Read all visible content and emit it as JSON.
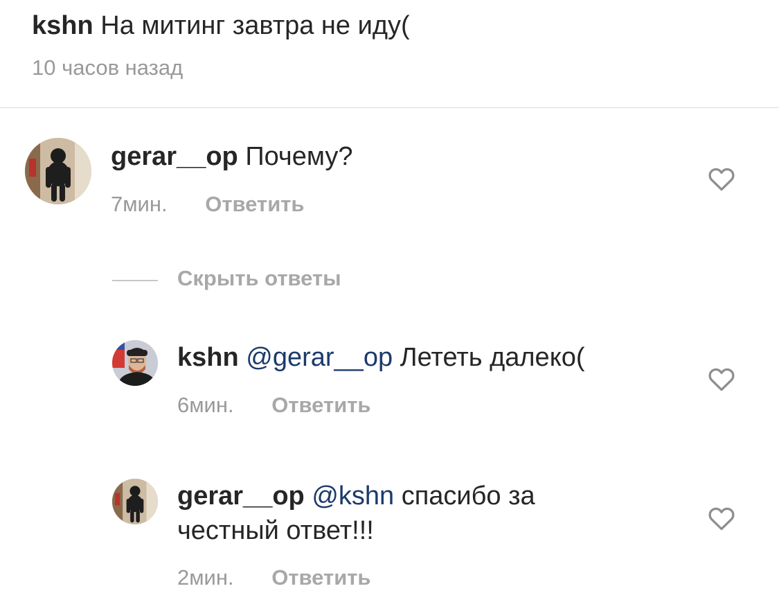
{
  "caption": {
    "username": "kshn",
    "text": "На митинг завтра не иду(",
    "time": "10 часов назад"
  },
  "comments": [
    {
      "username": "gerar__op",
      "mention": "",
      "text": "Почему?",
      "time": "7мин.",
      "reply_label": "Ответить"
    }
  ],
  "hide_replies_label": "Скрыть ответы",
  "replies": [
    {
      "username": "kshn",
      "mention": "@gerar__op",
      "text": "Лететь далеко(",
      "time": "6мин.",
      "reply_label": "Ответить"
    },
    {
      "username": "gerar__op",
      "mention": "@kshn",
      "text": "спасибо за честный ответ!!!",
      "time": "2мин.",
      "reply_label": "Ответить"
    }
  ],
  "icons": {
    "like": "heart-outline-icon",
    "avatar_gerar": "sculpture-avatar",
    "avatar_kshn": "person-avatar"
  },
  "colors": {
    "text": "#262626",
    "secondary": "#999999",
    "mention": "#1c3a6b",
    "divider": "#dbdbdb"
  }
}
